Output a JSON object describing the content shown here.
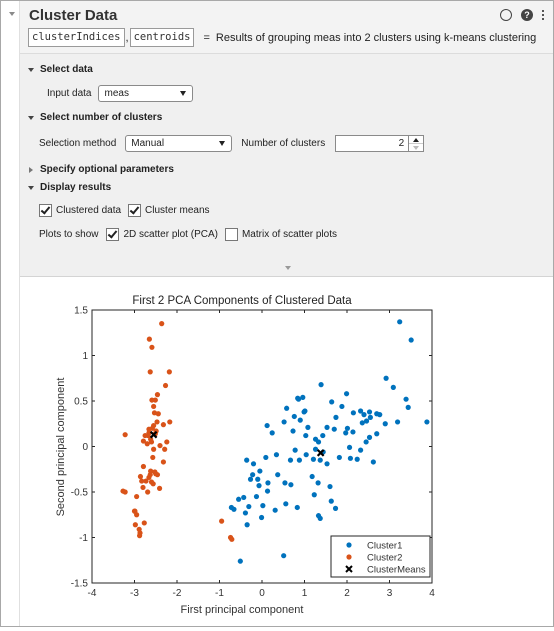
{
  "task": {
    "title": "Cluster Data",
    "outputs": [
      "clusterIndices",
      "centroids"
    ],
    "equals": "=",
    "description": "Results of grouping meas into 2 clusters using k-means clustering",
    "icons": [
      "circle-icon",
      "help-icon",
      "kebab-menu-icon"
    ],
    "help_glyph": "?"
  },
  "sections": {
    "select_data": {
      "label": "Select data",
      "expanded": true,
      "input_label": "Input data",
      "input_value": "meas"
    },
    "select_clusters": {
      "label": "Select number of clusters",
      "expanded": true,
      "method_label": "Selection method",
      "method_value": "Manual",
      "num_label": "Number of clusters",
      "num_value": "2"
    },
    "optional": {
      "label": "Specify optional parameters",
      "expanded": false
    },
    "display": {
      "label": "Display results",
      "expanded": true,
      "clustered_data": {
        "label": "Clustered data",
        "checked": true
      },
      "cluster_means": {
        "label": "Cluster means",
        "checked": true
      },
      "plots_label": "Plots to show",
      "scatter_2d": {
        "label": "2D scatter plot (PCA)",
        "checked": true
      },
      "scatter_matrix": {
        "label": "Matrix of scatter plots",
        "checked": false
      }
    }
  },
  "colors": {
    "cluster1": "#0072BD",
    "cluster2": "#D95319",
    "means": "#000000"
  },
  "chart_data": {
    "type": "scatter",
    "title": "First 2 PCA Components of Clustered Data",
    "xlabel": "First principal component",
    "ylabel": "Second principal component",
    "xlim": [
      -4,
      4
    ],
    "ylim": [
      -1.5,
      1.5
    ],
    "xticks": [
      "-4",
      "-3",
      "-2",
      "-1",
      "0",
      "1",
      "2",
      "3",
      "4"
    ],
    "yticks": [
      "1.5",
      "1",
      "0.5",
      "0",
      "-0.5",
      "-1",
      "-1.5"
    ],
    "grid": false,
    "legend": {
      "position": "bottom-right",
      "entries": [
        "Cluster1",
        "Cluster2",
        "ClusterMeans"
      ]
    },
    "series": [
      {
        "name": "Cluster1",
        "marker": "dot",
        "points": [
          [
            3.24,
            1.37
          ],
          [
            3.51,
            1.17
          ],
          [
            2.92,
            0.75
          ],
          [
            3.09,
            0.65
          ],
          [
            3.39,
            0.52
          ],
          [
            3.44,
            0.43
          ],
          [
            3.88,
            0.27
          ],
          [
            1.99,
            0.58
          ],
          [
            1.39,
            0.68
          ],
          [
            1.64,
            0.49
          ],
          [
            2.32,
            0.39
          ],
          [
            1.88,
            0.44
          ],
          [
            2.53,
            0.38
          ],
          [
            2.7,
            0.36
          ],
          [
            2.77,
            0.35
          ],
          [
            2.55,
            0.32
          ],
          [
            2.15,
            0.37
          ],
          [
            2.4,
            0.35
          ],
          [
            2.9,
            0.25
          ],
          [
            2.46,
            0.28
          ],
          [
            3.19,
            0.27
          ],
          [
            2.36,
            0.26
          ],
          [
            1.74,
            0.32
          ],
          [
            2.01,
            0.2
          ],
          [
            2.53,
            0.1
          ],
          [
            2.14,
            0.16
          ],
          [
            0.86,
            0.52
          ],
          [
            0.84,
            0.53
          ],
          [
            1.53,
            0.21
          ],
          [
            1.7,
            0.19
          ],
          [
            2.45,
            0.05
          ],
          [
            1.97,
            0.15
          ],
          [
            2.7,
            0.14
          ],
          [
            1.01,
            0.39
          ],
          [
            0.58,
            0.42
          ],
          [
            0.96,
            0.54
          ],
          [
            0.73,
            0.17
          ],
          [
            0.52,
            0.27
          ],
          [
            1.08,
            0.21
          ],
          [
            1.43,
            0.12
          ],
          [
            1.33,
            0.05
          ],
          [
            0.9,
            0.29
          ],
          [
            0.99,
            0.38
          ],
          [
            0.12,
            0.23
          ],
          [
            0.24,
            0.15
          ],
          [
            0.76,
            0.33
          ],
          [
            1.26,
            0.08
          ],
          [
            2.06,
            -0.01
          ],
          [
            2.32,
            -0.04
          ],
          [
            1.82,
            -0.12
          ],
          [
            2.08,
            -0.13
          ],
          [
            2.24,
            -0.14
          ],
          [
            2.62,
            -0.17
          ],
          [
            1.04,
            -0.09
          ],
          [
            0.78,
            -0.04
          ],
          [
            0.88,
            -0.15
          ],
          [
            0.67,
            -0.15
          ],
          [
            1.21,
            -0.14
          ],
          [
            1.37,
            -0.15
          ],
          [
            1.44,
            -0.06
          ],
          [
            1.26,
            -0.03
          ],
          [
            1.53,
            -0.19
          ],
          [
            0.34,
            -0.09
          ],
          [
            0.09,
            -0.12
          ],
          [
            -0.2,
            -0.19
          ],
          [
            -0.36,
            -0.15
          ],
          [
            -0.05,
            -0.27
          ],
          [
            -0.1,
            -0.36
          ],
          [
            -0.07,
            -0.43
          ],
          [
            -0.22,
            -0.31
          ],
          [
            -0.27,
            -0.36
          ],
          [
            -0.13,
            -0.55
          ],
          [
            0.13,
            -0.49
          ],
          [
            0.14,
            -0.4
          ],
          [
            0.54,
            -0.4
          ],
          [
            0.37,
            -0.31
          ],
          [
            1.18,
            -0.33
          ],
          [
            1.6,
            -0.44
          ],
          [
            1.32,
            -0.4
          ],
          [
            1.23,
            -0.53
          ],
          [
            1.73,
            -0.68
          ],
          [
            1.63,
            -0.6
          ],
          [
            0.83,
            -0.67
          ],
          [
            0.56,
            -0.63
          ],
          [
            -0.43,
            -0.56
          ],
          [
            -0.31,
            -0.66
          ],
          [
            -0.01,
            -0.78
          ],
          [
            -0.72,
            -0.67
          ],
          [
            -0.55,
            -0.58
          ],
          [
            -0.66,
            -0.69
          ],
          [
            -0.39,
            -0.73
          ],
          [
            0.02,
            -0.65
          ],
          [
            0.31,
            -0.7
          ],
          [
            0.68,
            -0.42
          ],
          [
            1.33,
            -0.76
          ],
          [
            1.37,
            -0.79
          ],
          [
            -0.35,
            -0.86
          ],
          [
            0.51,
            -1.2
          ],
          [
            -0.51,
            -1.26
          ],
          [
            1.03,
            0.12
          ]
        ]
      },
      {
        "name": "Cluster2",
        "marker": "dot",
        "points": [
          [
            -2.36,
            1.35
          ],
          [
            -2.65,
            1.18
          ],
          [
            -2.59,
            1.09
          ],
          [
            -2.18,
            0.82
          ],
          [
            -2.63,
            0.82
          ],
          [
            -2.27,
            0.67
          ],
          [
            -2.46,
            0.57
          ],
          [
            -2.59,
            0.51
          ],
          [
            -2.51,
            0.51
          ],
          [
            -2.55,
            0.44
          ],
          [
            -2.53,
            0.37
          ],
          [
            -2.44,
            0.36
          ],
          [
            -2.17,
            0.27
          ],
          [
            -2.47,
            0.27
          ],
          [
            -2.32,
            0.24
          ],
          [
            -2.55,
            0.23
          ],
          [
            -2.58,
            0.2
          ],
          [
            -2.66,
            0.15
          ],
          [
            -2.68,
            0.12
          ],
          [
            -2.49,
            0.17
          ],
          [
            -2.62,
            0.08
          ],
          [
            -2.4,
            0.01
          ],
          [
            -2.7,
            0.03
          ],
          [
            -2.55,
            -0.03
          ],
          [
            -2.29,
            -0.03
          ],
          [
            -3.22,
            0.13
          ],
          [
            -2.79,
            0.06
          ],
          [
            -2.6,
            0.05
          ],
          [
            -2.24,
            0.05
          ],
          [
            -2.75,
            0.12
          ],
          [
            -2.51,
            0.14
          ],
          [
            -2.66,
            0.19
          ],
          [
            -2.57,
            -0.12
          ],
          [
            -2.32,
            -0.17
          ],
          [
            -2.79,
            -0.22
          ],
          [
            -2.62,
            -0.27
          ],
          [
            -2.66,
            -0.34
          ],
          [
            -2.52,
            -0.28
          ],
          [
            -2.83,
            -0.38
          ],
          [
            -2.56,
            -0.41
          ],
          [
            -2.63,
            -0.31
          ],
          [
            -2.73,
            -0.38
          ],
          [
            -2.5,
            -0.3
          ],
          [
            -2.6,
            -0.39
          ],
          [
            -2.69,
            -0.5
          ],
          [
            -2.46,
            -0.31
          ],
          [
            -2.86,
            -0.33
          ],
          [
            -2.41,
            -0.46
          ],
          [
            -2.95,
            -0.55
          ],
          [
            -3.22,
            -0.5
          ],
          [
            -2.95,
            -0.75
          ],
          [
            -2.77,
            -0.84
          ],
          [
            -3.0,
            -0.71
          ],
          [
            -2.89,
            -0.91
          ],
          [
            -2.87,
            -0.95
          ],
          [
            -2.98,
            -0.86
          ],
          [
            -2.88,
            -0.98
          ],
          [
            -2.99,
            -0.71
          ],
          [
            -2.8,
            -0.45
          ],
          [
            -3.27,
            -0.49
          ],
          [
            -0.95,
            -0.82
          ],
          [
            -0.74,
            -1.0
          ],
          [
            -0.71,
            -1.02
          ]
        ]
      },
      {
        "name": "ClusterMeans",
        "marker": "x",
        "points": [
          [
            1.38,
            -0.07
          ],
          [
            -2.55,
            0.13
          ]
        ]
      }
    ]
  }
}
